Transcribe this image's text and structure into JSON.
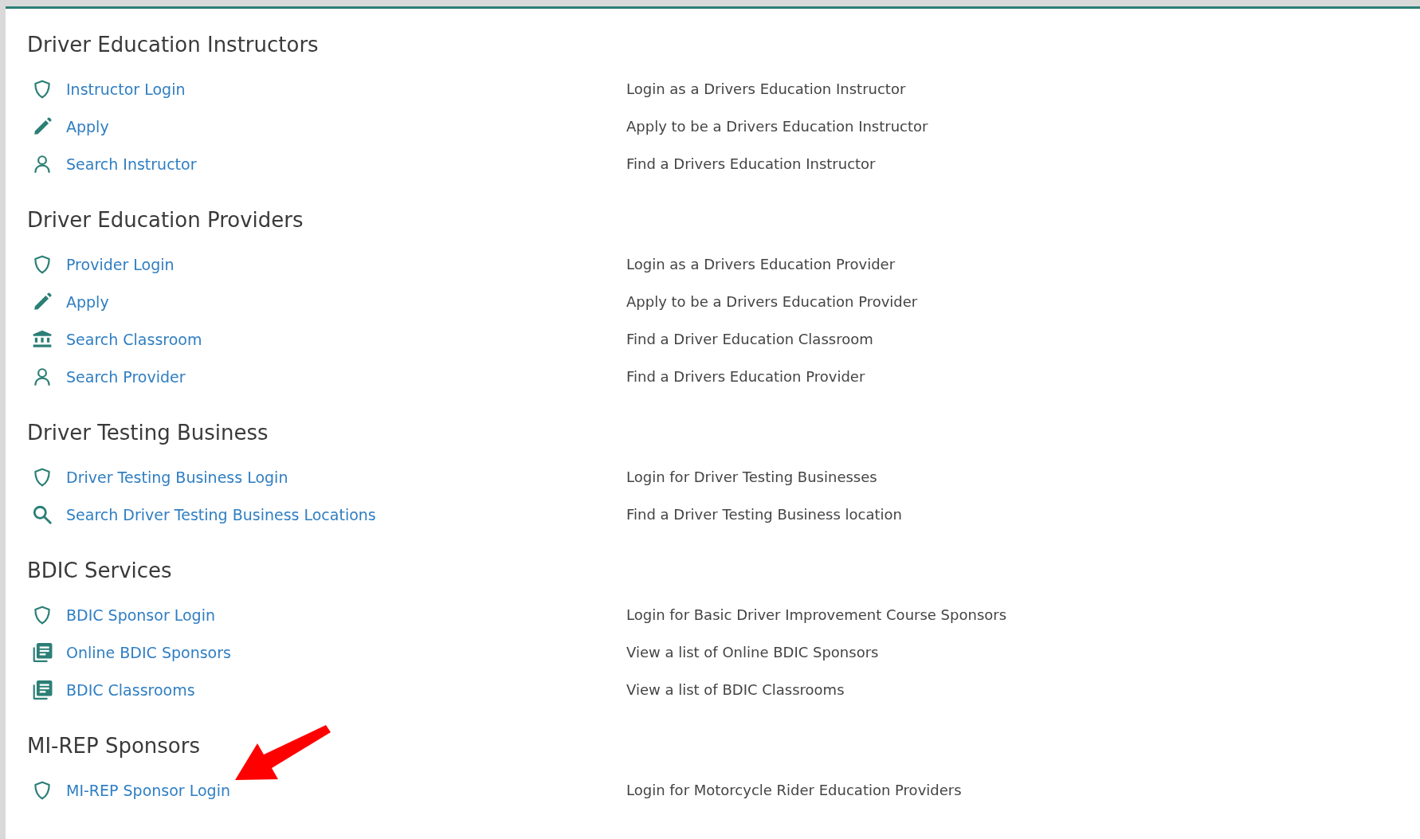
{
  "sections": [
    {
      "title": "Driver Education Instructors",
      "items": [
        {
          "kind": "shield",
          "label": "Instructor Login",
          "description": "Login as a Drivers Education Instructor"
        },
        {
          "kind": "pencil",
          "label": "Apply",
          "description": "Apply to be a Drivers Education Instructor"
        },
        {
          "kind": "person",
          "label": "Search Instructor",
          "description": "Find a Drivers Education Instructor"
        }
      ]
    },
    {
      "title": "Driver Education Providers",
      "items": [
        {
          "kind": "shield",
          "label": "Provider Login",
          "description": "Login as a Drivers Education Provider"
        },
        {
          "kind": "pencil",
          "label": "Apply",
          "description": "Apply to be a Drivers Education Provider"
        },
        {
          "kind": "building",
          "label": "Search Classroom",
          "description": "Find a Driver Education Classroom"
        },
        {
          "kind": "person",
          "label": "Search Provider",
          "description": "Find a Drivers Education Provider"
        }
      ]
    },
    {
      "title": "Driver Testing Business",
      "items": [
        {
          "kind": "shield",
          "label": "Driver Testing Business Login",
          "description": "Login for Driver Testing Businesses"
        },
        {
          "kind": "search",
          "label": "Search Driver Testing Business Locations",
          "description": "Find a Driver Testing Business location"
        }
      ]
    },
    {
      "title": "BDIC Services",
      "items": [
        {
          "kind": "shield",
          "label": "BDIC Sponsor Login",
          "description": "Login for Basic Driver Improvement Course Sponsors"
        },
        {
          "kind": "list",
          "label": "Online BDIC Sponsors",
          "description": "View a list of Online BDIC Sponsors"
        },
        {
          "kind": "list",
          "label": "BDIC Classrooms",
          "description": "View a list of BDIC Classrooms"
        }
      ]
    },
    {
      "title": "MI-REP Sponsors",
      "items": [
        {
          "kind": "shield",
          "label": "MI-REP Sponsor Login",
          "description": "Login for Motorcycle Rider Education Providers"
        }
      ]
    }
  ]
}
